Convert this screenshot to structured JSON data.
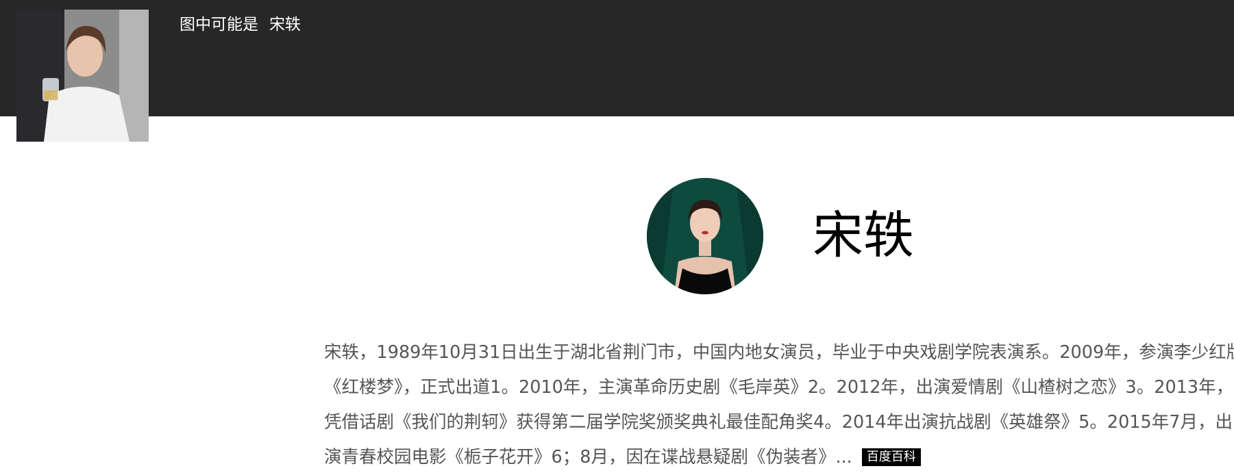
{
  "header": {
    "caption_prefix": "图中可能是",
    "caption_name": "宋轶"
  },
  "entity": {
    "name": "宋轶"
  },
  "description": {
    "lines": [
      "宋轶，1989年10月31日出生于湖北省荆门市，中国内地女演员，毕业于中央戏剧学院表演系。2009年，参演李少红版",
      "《红楼梦》，正式出道1。2010年，主演革命历史剧《毛岸英》2。2012年，出演爱情剧《山楂树之恋》3。2013年，",
      "凭借话剧《我们的荆轲》获得第二届学院奖颁奖典礼最佳配角奖4。2014年出演抗战剧《英雄祭》5。2015年7月，出",
      "演青春校园电影《栀子花开》6；8月，因在谍战悬疑剧《伪装者》..."
    ],
    "source_label": "百度百科"
  },
  "colors": {
    "header_bg": "#272727",
    "avatar_bg": "#0f4a3f",
    "badge_bg": "#000000",
    "text_gray": "#555555"
  }
}
